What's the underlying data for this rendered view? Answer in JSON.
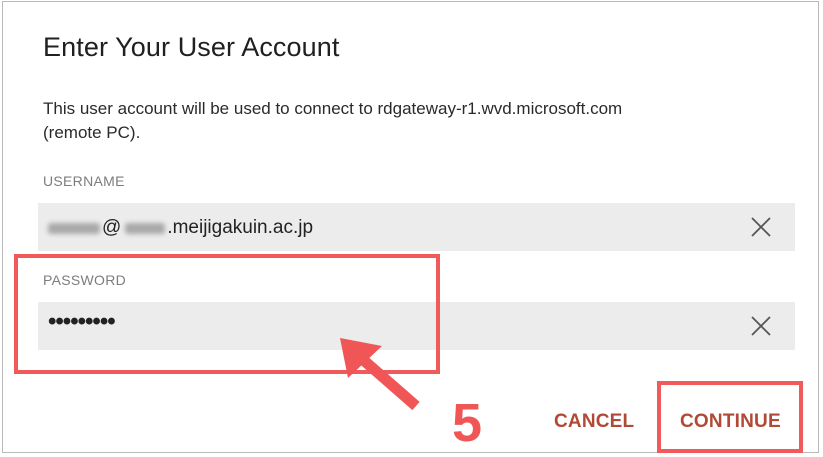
{
  "dialog": {
    "title": "Enter Your User Account",
    "description": "This user account will be used to connect to rdgateway-r1.wvd.microsoft.com (remote PC)."
  },
  "username": {
    "label": "USERNAME",
    "value_visible": "@ .meijigakuin.ac.jp",
    "value_suffix": ".meijigakuin.ac.jp",
    "clear_icon": "close-icon"
  },
  "password": {
    "label": "PASSWORD",
    "value_masked": "•••••••••",
    "clear_icon": "close-icon"
  },
  "actions": {
    "cancel_label": "CANCEL",
    "continue_label": "CONTINUE"
  },
  "annotation": {
    "step_number": "5",
    "highlight_color": "#f15a5a",
    "arrow_icon": "arrow-up-left-icon"
  },
  "colors": {
    "button_text": "#b04a36",
    "field_background": "#ececec"
  }
}
